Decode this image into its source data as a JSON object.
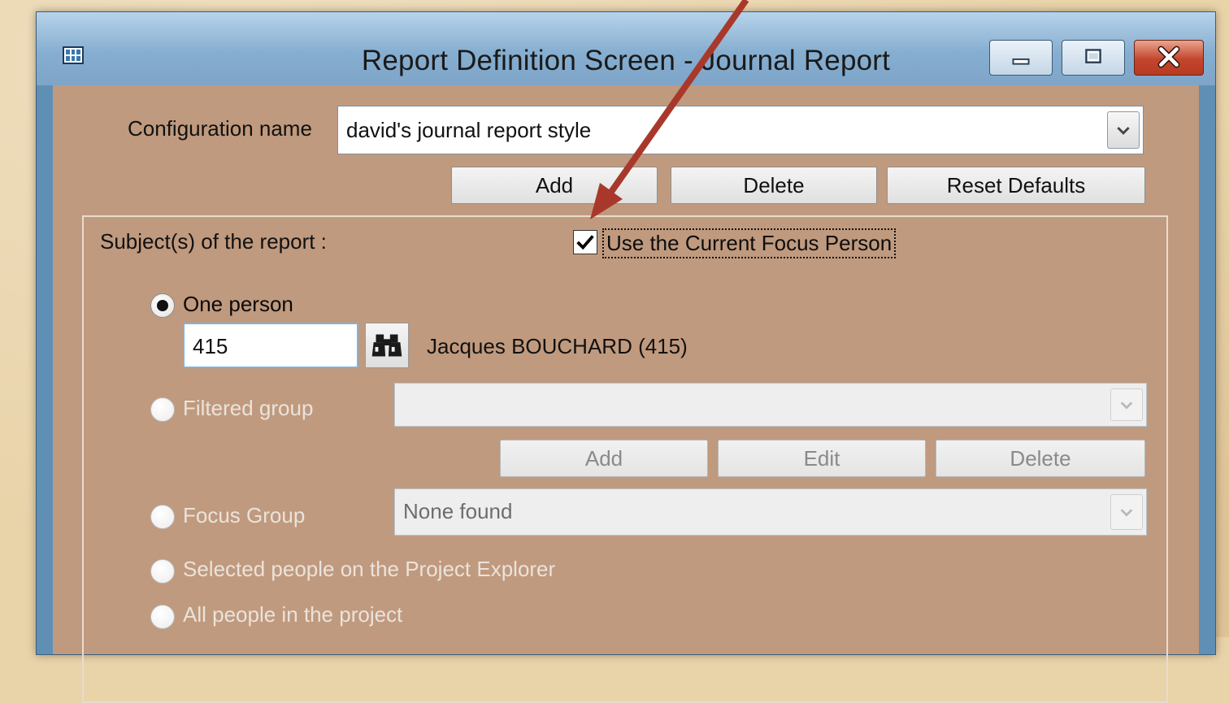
{
  "window": {
    "title": "Report Definition Screen - Journal Report",
    "icon": "report-icon",
    "controls": [
      "minimize-icon",
      "restore-icon",
      "close-icon"
    ]
  },
  "configuration": {
    "label": "Configuration name",
    "value": "david's journal report style",
    "buttons": {
      "add": "Add",
      "delete": "Delete",
      "reset": "Reset Defaults"
    }
  },
  "subjects": {
    "label": "Subject(s) of the report :",
    "use_focus_person": {
      "label": "Use the Current Focus Person",
      "checked": true
    },
    "options": {
      "one_person": {
        "label": "One person",
        "selected": true,
        "id_value": "415",
        "person_name": "Jacques BOUCHARD (415)",
        "search_icon": "binoculars-icon"
      },
      "filtered_group": {
        "label": "Filtered group",
        "enabled": false,
        "value": "",
        "buttons": {
          "add": "Add",
          "edit": "Edit",
          "delete": "Delete"
        }
      },
      "focus_group": {
        "label": "Focus Group",
        "enabled": false,
        "value": "None found"
      },
      "selected_people": {
        "label": "Selected people on the Project Explorer",
        "enabled": false
      },
      "all_people": {
        "label": "All people in the project",
        "enabled": false
      }
    }
  },
  "annotation": {
    "arrow_color": "#a8392a"
  },
  "colors": {
    "client_background": "#c09a7e",
    "titlebar": "#86aed0",
    "close_button": "#c4452d"
  }
}
